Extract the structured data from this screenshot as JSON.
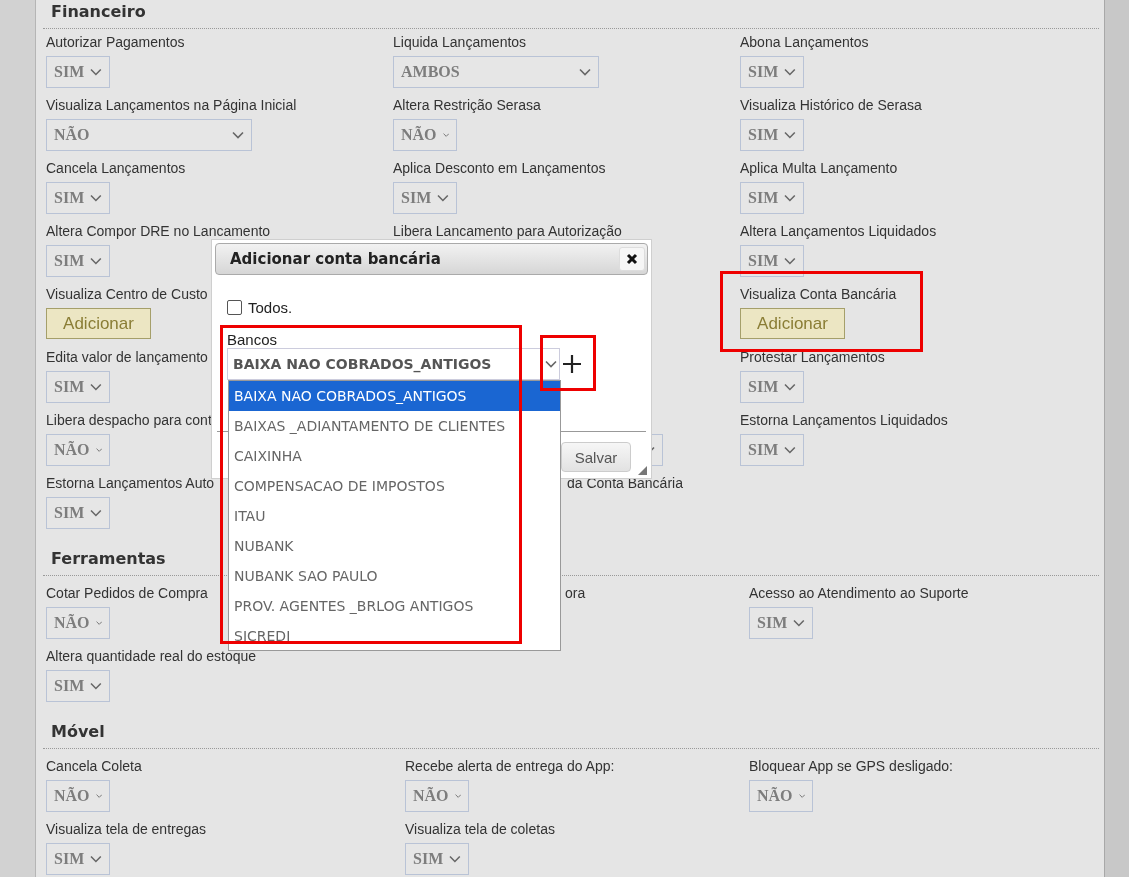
{
  "sections": [
    {
      "title": "Financeiro",
      "rows": [
        [
          {
            "label": "Autorizar Pagamentos",
            "kind": "select",
            "value": "SIM"
          },
          {
            "label": "Liquida Lançamentos",
            "kind": "wide-select",
            "value": "AMBOS"
          },
          {
            "label": "Abona Lançamentos",
            "kind": "select",
            "value": "SIM"
          }
        ],
        [
          {
            "label": "Visualiza Lançamentos na Página Inicial",
            "kind": "wide-select",
            "value": "NÃO"
          },
          {
            "label": "Altera Restrição Serasa",
            "kind": "select",
            "value": "NÃO"
          },
          {
            "label": "Visualiza Histórico de Serasa",
            "kind": "select",
            "value": "SIM"
          }
        ],
        [
          {
            "label": "Cancela Lançamentos",
            "kind": "select",
            "value": "SIM"
          },
          {
            "label": "Aplica Desconto em Lançamentos",
            "kind": "select",
            "value": "SIM"
          },
          {
            "label": "Aplica Multa Lançamento",
            "kind": "select",
            "value": "SIM"
          }
        ],
        [
          {
            "label": "Altera Compor DRE no Lancamento",
            "kind": "select",
            "value": "SIM"
          },
          {
            "label": "Libera Lancamento para Autorização",
            "kind": "label"
          },
          {
            "label": "Altera Lançamentos Liquidados",
            "kind": "select",
            "value": "SIM"
          }
        ],
        [
          {
            "label": "Visualiza Centro de Custo",
            "kind": "button",
            "value": "Adicionar"
          },
          null,
          {
            "label": "Visualiza Conta Bancária",
            "kind": "button",
            "value": "Adicionar"
          }
        ],
        [
          {
            "label": "Edita valor de lançamento",
            "kind": "select",
            "value": "SIM"
          },
          null,
          {
            "label": "Protestar Lançamentos",
            "kind": "select",
            "value": "SIM"
          }
        ],
        [
          {
            "label": "Libera despacho para cont",
            "kind": "select",
            "value": "NÃO"
          },
          {
            "kind": "long-select"
          },
          {
            "label": "Estorna Lançamentos Liquidados",
            "kind": "select",
            "value": "SIM"
          }
        ],
        [
          {
            "label": "Estorna Lançamentos Auto",
            "kind": "select",
            "value": "SIM"
          },
          {
            "label": "da Conta Bancária",
            "kind": "tail-label"
          },
          null
        ]
      ]
    },
    {
      "title": "Ferramentas",
      "rows": [
        [
          {
            "label": "Cotar Pedidos de Compra",
            "kind": "select",
            "value": "NÃO"
          },
          {
            "label": "ora",
            "kind": "tail-label"
          },
          {
            "label": "Acesso ao Atendimento ao Suporte",
            "kind": "select",
            "value": "SIM"
          }
        ],
        [
          {
            "label": "Altera quantidade real do estoque",
            "kind": "select",
            "value": "SIM"
          },
          null,
          null
        ]
      ]
    },
    {
      "title": "Móvel",
      "rows": [
        [
          {
            "label": "Cancela Coleta",
            "kind": "select",
            "value": "NÃO"
          },
          {
            "label": "Recebe alerta de entrega do App:",
            "kind": "select",
            "value": "NÃO"
          },
          {
            "label": "Bloquear App se GPS desligado:",
            "kind": "select",
            "value": "NÃO"
          }
        ],
        [
          {
            "label": "Visualiza tela de entregas",
            "kind": "select",
            "value": "SIM"
          },
          {
            "label": "Visualiza tela de coletas",
            "kind": "select",
            "value": "SIM"
          },
          null
        ]
      ]
    }
  ],
  "dialog": {
    "title": "Adicionar conta bancária",
    "all_option": {
      "label": "Todos.",
      "checked": false
    },
    "field_label": "Bancos",
    "value": "BAIXA NAO COBRADOS_ANTIGOS",
    "options": [
      {
        "label": "BAIXA NAO COBRADOS_ANTIGOS",
        "selected": true
      },
      {
        "label": "BAIXAS _ADIANTAMENTO DE CLIENTES",
        "selected": false
      },
      {
        "label": "CAIXINHA",
        "selected": false
      },
      {
        "label": "COMPENSACAO DE IMPOSTOS",
        "selected": false
      },
      {
        "label": "ITAU",
        "selected": false
      },
      {
        "label": "NUBANK",
        "selected": false
      },
      {
        "label": "NUBANK SAO PAULO",
        "selected": false
      },
      {
        "label": "PROV. AGENTES _BRLOG ANTIGOS",
        "selected": false
      },
      {
        "label": "SICREDI",
        "selected": false
      }
    ],
    "save_button": "Salvar"
  }
}
